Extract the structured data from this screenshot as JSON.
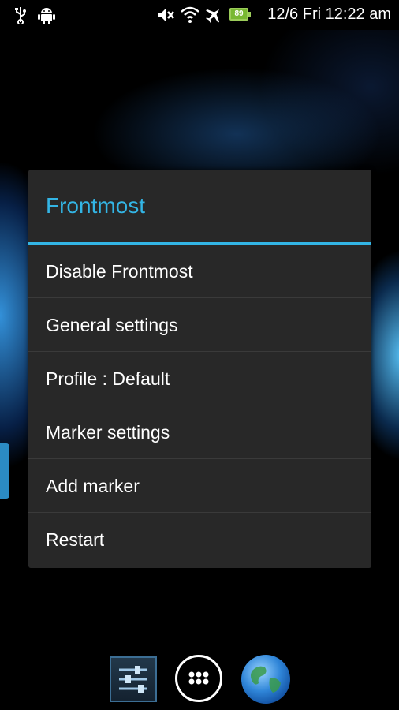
{
  "status_bar": {
    "icons": [
      "usb-icon",
      "android-icon",
      "mute-icon",
      "wifi-icon",
      "airplane-icon",
      "battery-icon"
    ],
    "battery_level": "89",
    "date_time": "12/6 Fri 12:22 am"
  },
  "dialog": {
    "title": "Frontmost",
    "accent_color": "#33b5e5",
    "items": [
      {
        "label": "Disable Frontmost"
      },
      {
        "label": "General settings"
      },
      {
        "label": "Profile : Default"
      },
      {
        "label": "Marker settings"
      },
      {
        "label": "Add marker"
      },
      {
        "label": "Restart"
      }
    ]
  },
  "dock": {
    "icons": [
      "settings-sliders-icon",
      "app-drawer-icon",
      "browser-globe-icon"
    ]
  }
}
